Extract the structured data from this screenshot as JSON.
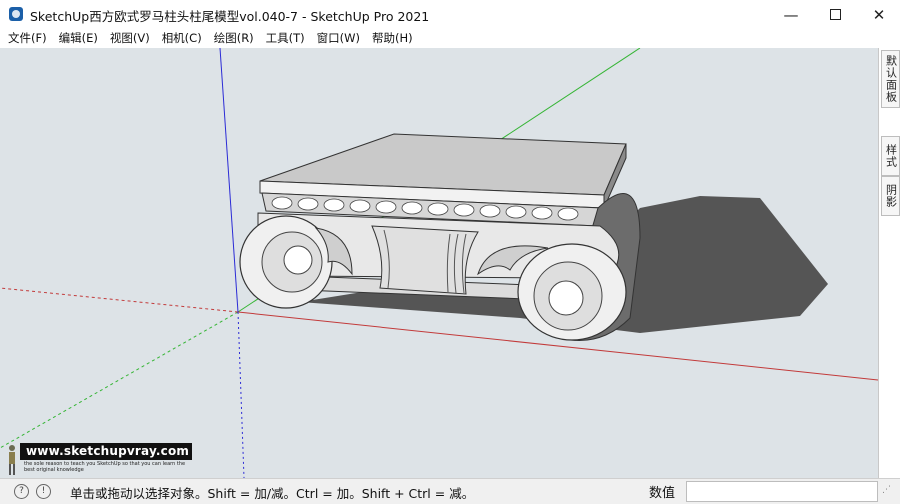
{
  "window": {
    "title": "SketchUp西方欧式罗马柱头柱尾模型vol.040-7 - SketchUp Pro 2021",
    "controls": {
      "minimize": "—",
      "close": "✕"
    }
  },
  "menu": [
    "文件(F)",
    "编辑(E)",
    "视图(V)",
    "相机(C)",
    "绘图(R)",
    "工具(T)",
    "窗口(W)",
    "帮助(H)"
  ],
  "tray": {
    "tabs": [
      "默认面板",
      "样式",
      "阴影"
    ]
  },
  "status": {
    "hint": "单击或拖动以选择对象。Shift = 加/减。Ctrl = 加。Shift + Ctrl = 减。",
    "measurements_label": "数值",
    "measurements_value": ""
  },
  "watermark": {
    "site": "www.sketchupvray.com",
    "tagline": "the sole reason to teach you SketchUp so that you can learn the best original knowledge"
  },
  "colors": {
    "viewport_bg": "#dde3e7",
    "axis_red": "#c23a3a",
    "axis_green": "#35b535",
    "axis_blue": "#2b2bd6",
    "model_face": "#ececec",
    "shadow": "#555555"
  },
  "icons": {
    "app": "sketchup-logo-icon",
    "geolocation": "geolocation-icon",
    "info": "info-icon"
  }
}
